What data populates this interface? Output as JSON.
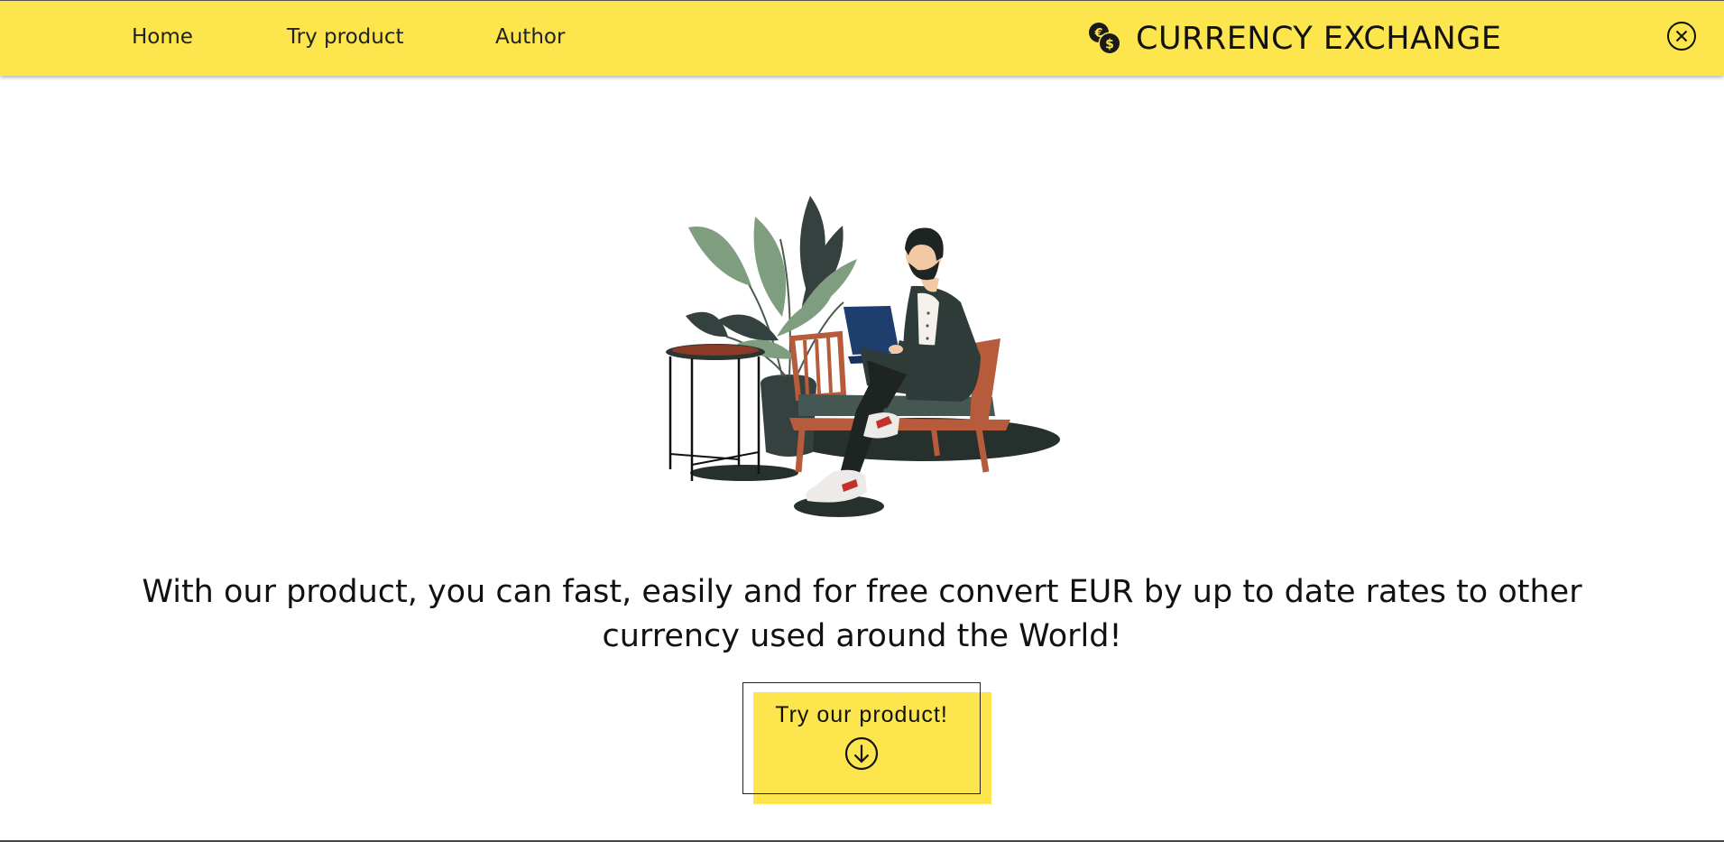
{
  "nav": {
    "items": [
      {
        "label": "Home"
      },
      {
        "label": "Try product"
      },
      {
        "label": "Author"
      }
    ]
  },
  "brand": {
    "title": "CURRENCY EXCHANGE",
    "icon": "coins-icon"
  },
  "header_controls": {
    "close_icon": "close-circle-icon"
  },
  "hero": {
    "illustration": "man-with-laptop-illustration",
    "tagline": "With our product, you can fast, easily and for free convert EUR by up to date rates to other currency used around the World!"
  },
  "cta": {
    "label": "Try our product!",
    "icon": "arrow-down-circle-icon"
  },
  "colors": {
    "accent": "#fde54e",
    "text": "#111111"
  }
}
